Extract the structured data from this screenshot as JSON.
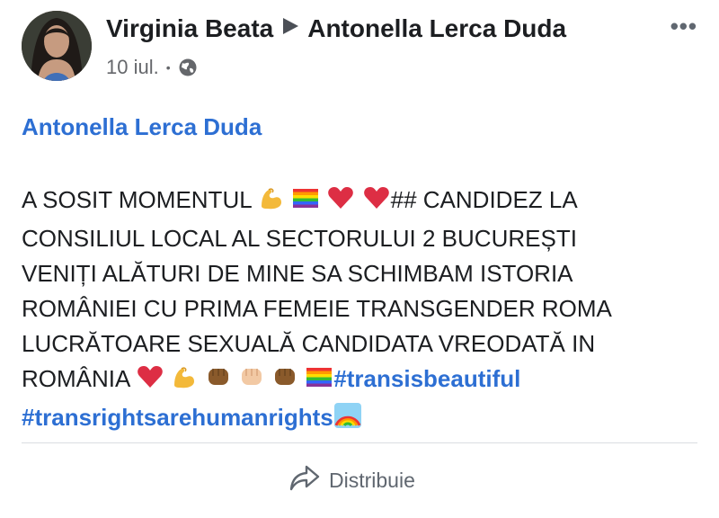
{
  "post": {
    "author": "Virginia Beata",
    "target": "Antonella Lerca Duda",
    "date": "10 iul.",
    "separator": "•",
    "more_label": "•••",
    "tagged_name": "Antonella Lerca Duda",
    "text_lines": [
      "A SOSIT MOMENTUL ",
      "## CANDIDEZ LA",
      "CONSILIUL LOCAL AL SECTORULUI 2 BUCUREȘTI",
      "VENIȚI ALĂTURI DE MINE SA SCHIMBAM ISTORIA",
      "ROMÂNIEI CU PRIMA FEMEIE TRANSGENDER ROMA",
      "LUCRĂTOARE SEXUALĂ CANDIDATA VREODATĂ IN",
      "ROMÂNIA "
    ],
    "hashtags": [
      "#transisbeautiful",
      "#transrightsarehumanrights"
    ],
    "share_label": "Distribuie"
  },
  "icons": [
    "globe-icon",
    "more-icon",
    "share-icon",
    "muscle-emoji",
    "rainbow-flag-emoji",
    "red-heart-emoji",
    "raised-fist-emoji",
    "rainbow-emoji"
  ],
  "colors": {
    "link_blue": "#2d6fd3",
    "text": "#1c1e21",
    "meta_gray": "#65676b",
    "divider": "#dadde1"
  }
}
